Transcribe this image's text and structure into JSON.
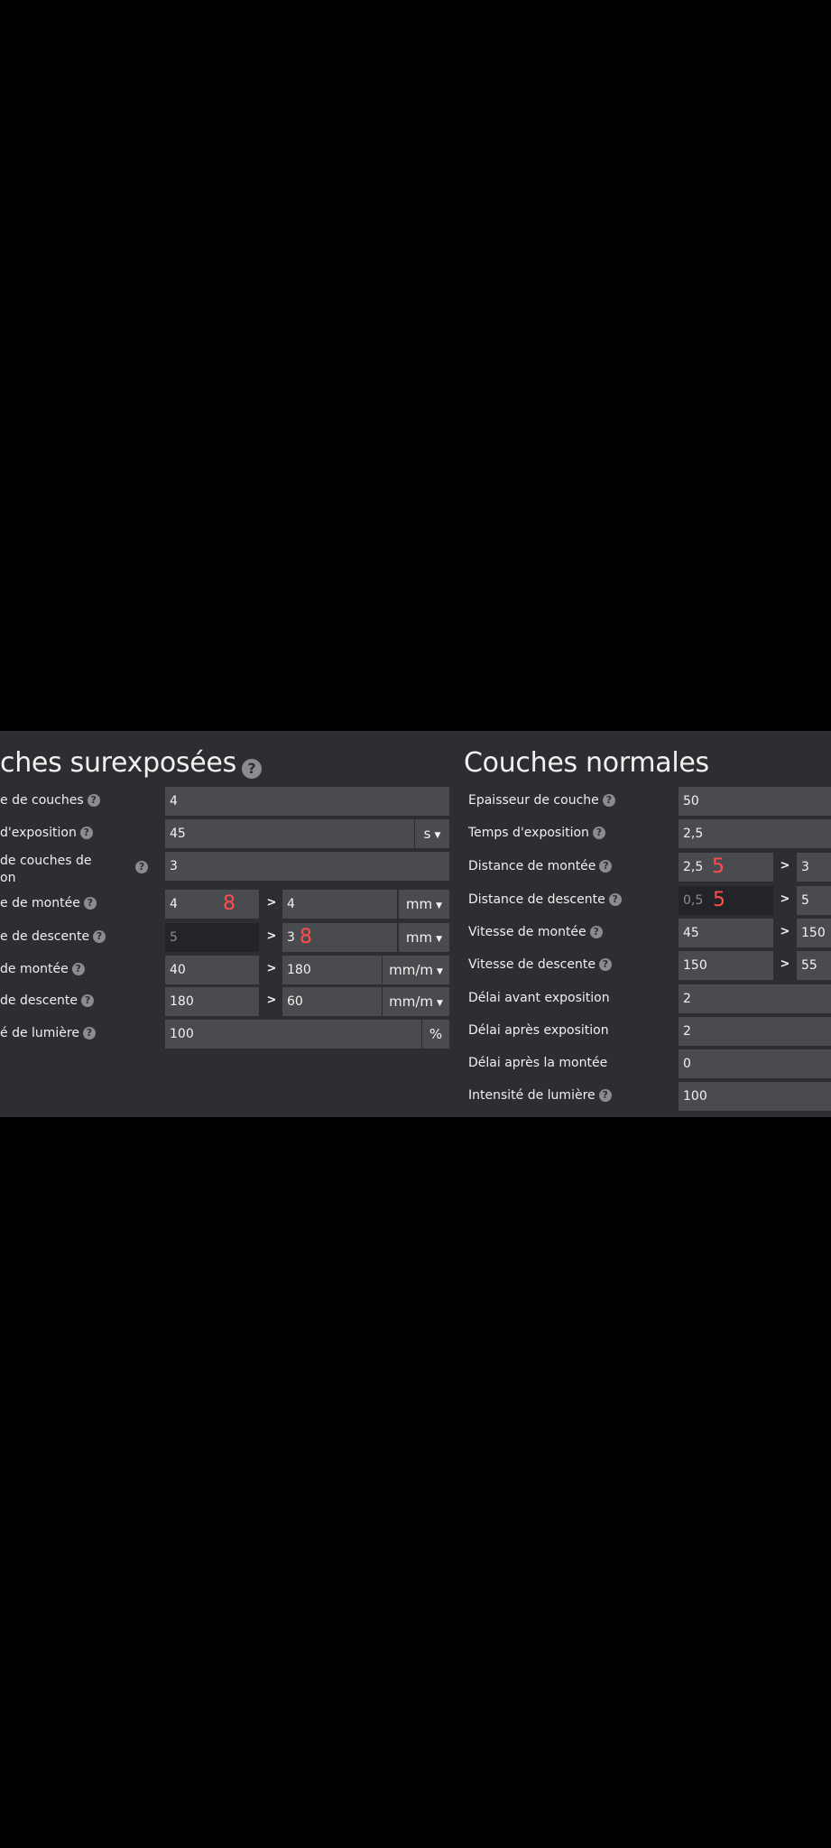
{
  "left": {
    "title": "ches surexposées",
    "rows": [
      {
        "label": "e de couches",
        "value": "4"
      },
      {
        "label": "d'exposition",
        "value": "45",
        "unit": "s"
      },
      {
        "label_line1": "de couches de",
        "label_line2": "on",
        "value": "3"
      },
      {
        "label": "e de montée",
        "value_from": "4",
        "annotation_from": "8",
        "value_to": "4",
        "unit": "mm"
      },
      {
        "label": "e de descente",
        "value_from": "5",
        "value_to": "3",
        "annotation_to": "8",
        "unit": "mm"
      },
      {
        "label": "de montée",
        "value_from": "40",
        "value_to": "180",
        "unit": "mm/m"
      },
      {
        "label": "de descente",
        "value_from": "180",
        "value_to": "60",
        "unit": "mm/m"
      },
      {
        "label": "é de lumière",
        "value": "100",
        "unit": "%"
      }
    ]
  },
  "right": {
    "title": "Couches normales",
    "rows": [
      {
        "label": "Epaisseur de couche",
        "value": "50"
      },
      {
        "label": "Temps d'exposition",
        "value": "2,5"
      },
      {
        "label": "Distance de montée",
        "value_from": "2,5",
        "annotation_from": "5",
        "value_to": "3"
      },
      {
        "label": "Distance de descente",
        "value_from": "0,5",
        "annotation_from": "5",
        "value_to": "5"
      },
      {
        "label": "Vitesse de montée",
        "value_from": "45",
        "value_to": "150"
      },
      {
        "label": "Vitesse de descente",
        "value_from": "150",
        "value_to": "55"
      },
      {
        "label": "Délai avant exposition",
        "value": "2"
      },
      {
        "label": "Délai après exposition",
        "value": "2"
      },
      {
        "label": "Délai après la montée",
        "value": "0"
      },
      {
        "label": "Intensité de lumière",
        "value": "100"
      }
    ]
  },
  "symbols": {
    "help": "?",
    "greater": ">"
  },
  "colors": {
    "panel": "#2d2e31",
    "input": "#4a4b4e",
    "annotation": "#ff4d4d"
  }
}
